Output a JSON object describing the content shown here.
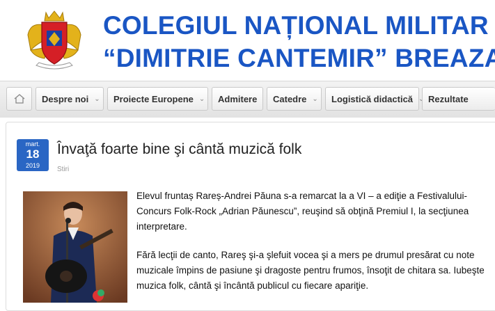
{
  "header": {
    "title_line1": "COLEGIUL NAȚIONAL MILITAR",
    "title_line2": "“DIMITRIE CANTEMIR” BREAZA"
  },
  "nav": {
    "home_icon": "home-icon",
    "items": [
      {
        "label": "Despre noi",
        "dropdown": true
      },
      {
        "label": "Proiecte Europene",
        "dropdown": true
      },
      {
        "label": "Admitere",
        "dropdown": false
      },
      {
        "label": "Catedre",
        "dropdown": true
      },
      {
        "label": "Logistică didactică",
        "dropdown": true
      },
      {
        "label": "Rezultate",
        "dropdown": false
      }
    ]
  },
  "post": {
    "date": {
      "month": "mart.",
      "day": "18",
      "year": "2019"
    },
    "title": "Învaţă foarte bine şi cântă muzică folk",
    "category": "Stiri",
    "paragraph1": "Elevul fruntaș Rareș-Andrei Păuna s-a remarcat la a VI – a ediţie a Festivalului-Concurs Folk-Rock  „Adrian Păunescu”, reuşind să obţină Premiul I, la secţiunea interpretare.",
    "paragraph2": "Fără lecţii de canto, Rareş şi-a şlefuit vocea şi a mers pe drumul presărat cu note muzicale împins de pasiune şi dragoste pentru frumos, însoţit de chitara sa. Iubeşte muzica folk, cântă şi încântă publicul cu fiecare apariţie."
  },
  "colors": {
    "title_blue": "#1a56c4",
    "badge_blue": "#2a66c4"
  }
}
